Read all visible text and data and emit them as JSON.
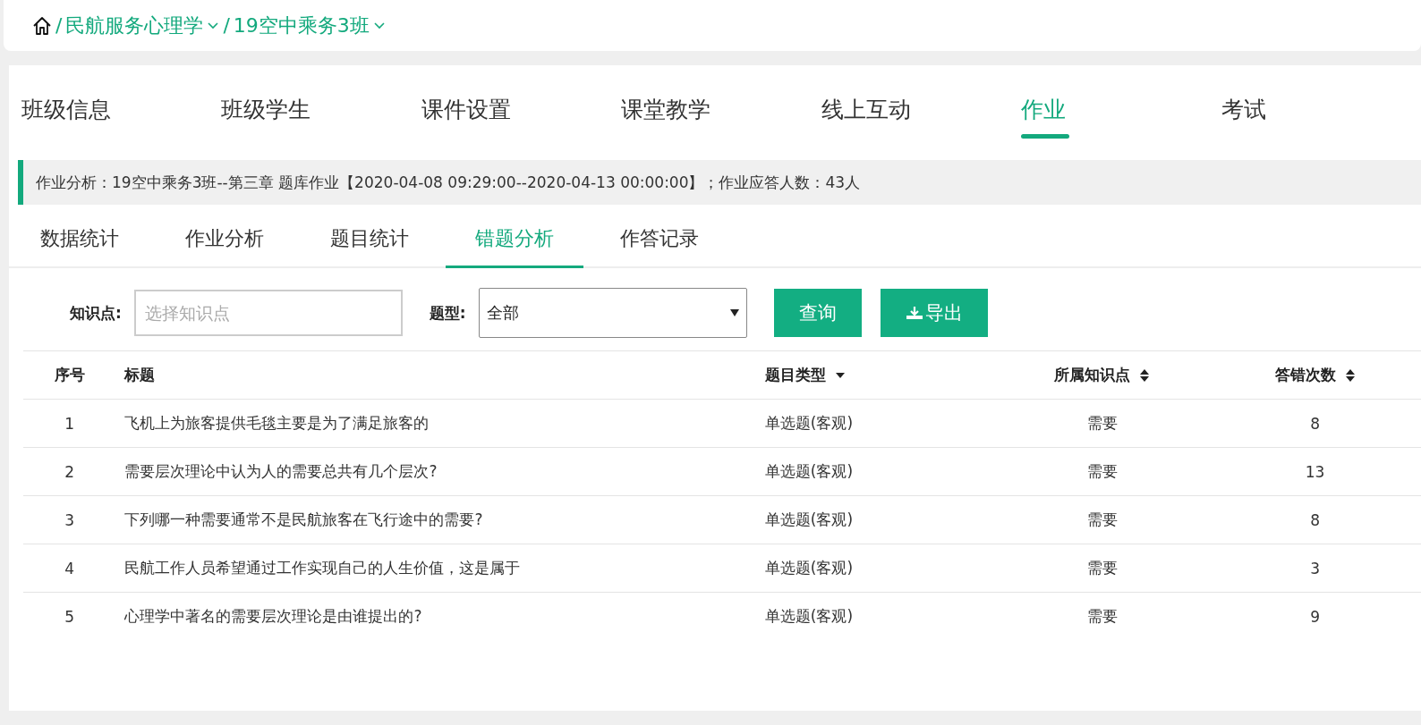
{
  "breadcrumb": [
    {
      "separator": "/",
      "label": "民航服务心理学",
      "dropdown": true
    },
    {
      "separator": "/",
      "label": "19空中乘务3班",
      "dropdown": true
    }
  ],
  "tabs": [
    {
      "label": "班级信息",
      "selected": false
    },
    {
      "label": "班级学生",
      "selected": false
    },
    {
      "label": "课件设置",
      "selected": false
    },
    {
      "label": "课堂教学",
      "selected": false
    },
    {
      "label": "线上互动",
      "selected": false
    },
    {
      "label": "作业",
      "selected": true
    },
    {
      "label": "考试",
      "selected": false
    }
  ],
  "info_bar": "作业分析：19空中乘务3班--第三章 题库作业【2020-04-08 09:29:00--2020-04-13 00:00:00】；作业应答人数：43人",
  "sub_tabs": [
    {
      "label": "数据统计",
      "selected": false
    },
    {
      "label": "作业分析",
      "selected": false
    },
    {
      "label": "题目统计",
      "selected": false
    },
    {
      "label": "错题分析",
      "selected": true
    },
    {
      "label": "作答记录",
      "selected": false
    }
  ],
  "filters": {
    "knowledge_label": "知识点:",
    "knowledge_placeholder": "选择知识点",
    "type_label": "题型:",
    "type_value": "全部",
    "query_button": "查询",
    "export_button": "导出"
  },
  "table": {
    "columns": [
      {
        "label": "序号"
      },
      {
        "label": "标题"
      },
      {
        "label": "题目类型",
        "sorted_desc": true
      },
      {
        "label": "所属知识点",
        "sorted_desc": false
      },
      {
        "label": "答错次数",
        "sorted_desc": false
      }
    ],
    "rows": [
      [
        "1",
        "飞机上为旅客提供毛毯主要是为了满足旅客的",
        "单选题(客观)",
        "需要",
        "8"
      ],
      [
        "2",
        "需要层次理论中认为人的需要总共有几个层次?",
        "单选题(客观)",
        "需要",
        "13"
      ],
      [
        "3",
        "下列哪一种需要通常不是民航旅客在飞行途中的需要?",
        "单选题(客观)",
        "需要",
        "8"
      ],
      [
        "4",
        "民航工作人员希望通过工作实现自己的人生价值，这是属于",
        "单选题(客观)",
        "需要",
        "3"
      ],
      [
        "5",
        "心理学中著名的需要层次理论是由谁提出的?",
        "单选题(客观)",
        "需要",
        "9"
      ]
    ]
  }
}
